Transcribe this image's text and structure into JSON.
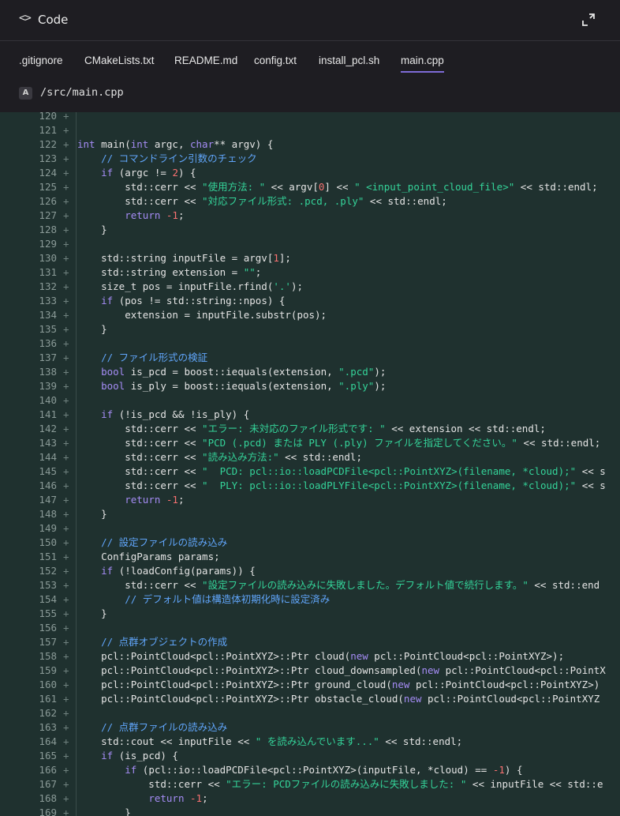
{
  "header": {
    "code_icon": "<>",
    "title": "Code",
    "expand_icon": "expand-icon"
  },
  "tabs": [
    {
      "label": ".gitignore",
      "active": false
    },
    {
      "label": "CMakeLists.txt",
      "active": false
    },
    {
      "label": "README.md",
      "active": false
    },
    {
      "label": "config.txt",
      "active": false
    },
    {
      "label": "install_pcl.sh",
      "active": false
    },
    {
      "label": "main.cpp",
      "active": true
    }
  ],
  "file": {
    "badge": "A",
    "path": "/src/main.cpp"
  },
  "colors": {
    "keyword": "#a58cf5",
    "string": "#34d399",
    "number": "#f87171",
    "comment": "#60a5fa",
    "accent": "#7e6bd6"
  },
  "lines": [
    {
      "n": "120",
      "t": [
        [
          "",
          ""
        ]
      ]
    },
    {
      "n": "121",
      "t": [
        [
          "",
          ""
        ]
      ]
    },
    {
      "n": "122",
      "t": [
        [
          "kw",
          "int"
        ],
        [
          "",
          " main("
        ],
        [
          "kw",
          "int"
        ],
        [
          "",
          " argc, "
        ],
        [
          "kw",
          "char"
        ],
        [
          "",
          "** argv) {"
        ]
      ]
    },
    {
      "n": "123",
      "t": [
        [
          "",
          "    "
        ],
        [
          "cm",
          "// コマンドライン引数のチェック"
        ]
      ]
    },
    {
      "n": "124",
      "t": [
        [
          "",
          "    "
        ],
        [
          "kw",
          "if"
        ],
        [
          "",
          " (argc != "
        ],
        [
          "num",
          "2"
        ],
        [
          "",
          ") {"
        ]
      ]
    },
    {
      "n": "125",
      "t": [
        [
          "",
          "        std::cerr << "
        ],
        [
          "str",
          "\"使用方法: \""
        ],
        [
          "",
          " << argv["
        ],
        [
          "num",
          "0"
        ],
        [
          "",
          "] << "
        ],
        [
          "str",
          "\" <input_point_cloud_file>\""
        ],
        [
          "",
          " << std::endl;"
        ]
      ]
    },
    {
      "n": "126",
      "t": [
        [
          "",
          "        std::cerr << "
        ],
        [
          "str",
          "\"対応ファイル形式: .pcd, .ply\""
        ],
        [
          "",
          " << std::endl;"
        ]
      ]
    },
    {
      "n": "127",
      "t": [
        [
          "",
          "        "
        ],
        [
          "kw",
          "return"
        ],
        [
          "",
          " "
        ],
        [
          "num",
          "-1"
        ],
        [
          "",
          ";"
        ]
      ]
    },
    {
      "n": "128",
      "t": [
        [
          "",
          "    }"
        ]
      ]
    },
    {
      "n": "129",
      "t": [
        [
          "",
          ""
        ]
      ]
    },
    {
      "n": "130",
      "t": [
        [
          "",
          "    std::string inputFile = argv["
        ],
        [
          "num",
          "1"
        ],
        [
          "",
          "];"
        ]
      ]
    },
    {
      "n": "131",
      "t": [
        [
          "",
          "    std::string extension = "
        ],
        [
          "str",
          "\"\""
        ],
        [
          "",
          ";"
        ]
      ]
    },
    {
      "n": "132",
      "t": [
        [
          "",
          "    size_t pos = inputFile.rfind("
        ],
        [
          "str",
          "'.'"
        ],
        [
          "",
          ");"
        ]
      ]
    },
    {
      "n": "133",
      "t": [
        [
          "",
          "    "
        ],
        [
          "kw",
          "if"
        ],
        [
          "",
          " (pos != std::string::npos) {"
        ]
      ]
    },
    {
      "n": "134",
      "t": [
        [
          "",
          "        extension = inputFile.substr(pos);"
        ]
      ]
    },
    {
      "n": "135",
      "t": [
        [
          "",
          "    }"
        ]
      ]
    },
    {
      "n": "136",
      "t": [
        [
          "",
          ""
        ]
      ]
    },
    {
      "n": "137",
      "t": [
        [
          "",
          "    "
        ],
        [
          "cm",
          "// ファイル形式の検証"
        ]
      ]
    },
    {
      "n": "138",
      "t": [
        [
          "",
          "    "
        ],
        [
          "kw",
          "bool"
        ],
        [
          "",
          " is_pcd = boost::iequals(extension, "
        ],
        [
          "str",
          "\".pcd\""
        ],
        [
          "",
          ");"
        ]
      ]
    },
    {
      "n": "139",
      "t": [
        [
          "",
          "    "
        ],
        [
          "kw",
          "bool"
        ],
        [
          "",
          " is_ply = boost::iequals(extension, "
        ],
        [
          "str",
          "\".ply\""
        ],
        [
          "",
          ");"
        ]
      ]
    },
    {
      "n": "140",
      "t": [
        [
          "",
          ""
        ]
      ]
    },
    {
      "n": "141",
      "t": [
        [
          "",
          "    "
        ],
        [
          "kw",
          "if"
        ],
        [
          "",
          " (!is_pcd && !is_ply) {"
        ]
      ]
    },
    {
      "n": "142",
      "t": [
        [
          "",
          "        std::cerr << "
        ],
        [
          "str",
          "\"エラー: 未対応のファイル形式です: \""
        ],
        [
          "",
          " << extension << std::endl;"
        ]
      ]
    },
    {
      "n": "143",
      "t": [
        [
          "",
          "        std::cerr << "
        ],
        [
          "str",
          "\"PCD (.pcd) または PLY (.ply) ファイルを指定してください。\""
        ],
        [
          "",
          " << std::endl;"
        ]
      ]
    },
    {
      "n": "144",
      "t": [
        [
          "",
          "        std::cerr << "
        ],
        [
          "str",
          "\"読み込み方法:\""
        ],
        [
          "",
          " << std::endl;"
        ]
      ]
    },
    {
      "n": "145",
      "t": [
        [
          "",
          "        std::cerr << "
        ],
        [
          "str",
          "\"  PCD: pcl::io::loadPCDFile<pcl::PointXYZ>(filename, *cloud);\""
        ],
        [
          "",
          " << s"
        ]
      ]
    },
    {
      "n": "146",
      "t": [
        [
          "",
          "        std::cerr << "
        ],
        [
          "str",
          "\"  PLY: pcl::io::loadPLYFile<pcl::PointXYZ>(filename, *cloud);\""
        ],
        [
          "",
          " << s"
        ]
      ]
    },
    {
      "n": "147",
      "t": [
        [
          "",
          "        "
        ],
        [
          "kw",
          "return"
        ],
        [
          "",
          " "
        ],
        [
          "num",
          "-1"
        ],
        [
          "",
          ";"
        ]
      ]
    },
    {
      "n": "148",
      "t": [
        [
          "",
          "    }"
        ]
      ]
    },
    {
      "n": "149",
      "t": [
        [
          "",
          ""
        ]
      ]
    },
    {
      "n": "150",
      "t": [
        [
          "",
          "    "
        ],
        [
          "cm",
          "// 設定ファイルの読み込み"
        ]
      ]
    },
    {
      "n": "151",
      "t": [
        [
          "",
          "    ConfigParams params;"
        ]
      ]
    },
    {
      "n": "152",
      "t": [
        [
          "",
          "    "
        ],
        [
          "kw",
          "if"
        ],
        [
          "",
          " (!loadConfig(params)) {"
        ]
      ]
    },
    {
      "n": "153",
      "t": [
        [
          "",
          "        std::cerr << "
        ],
        [
          "str",
          "\"設定ファイルの読み込みに失敗しました。デフォルト値で続行します。\""
        ],
        [
          "",
          " << std::end"
        ]
      ]
    },
    {
      "n": "154",
      "t": [
        [
          "",
          "        "
        ],
        [
          "cm",
          "// デフォルト値は構造体初期化時に設定済み"
        ]
      ]
    },
    {
      "n": "155",
      "t": [
        [
          "",
          "    }"
        ]
      ]
    },
    {
      "n": "156",
      "t": [
        [
          "",
          ""
        ]
      ]
    },
    {
      "n": "157",
      "t": [
        [
          "",
          "    "
        ],
        [
          "cm",
          "// 点群オブジェクトの作成"
        ]
      ]
    },
    {
      "n": "158",
      "t": [
        [
          "",
          "    pcl::PointCloud<pcl::PointXYZ>::Ptr cloud("
        ],
        [
          "kw",
          "new"
        ],
        [
          "",
          " pcl::PointCloud<pcl::PointXYZ>);"
        ]
      ]
    },
    {
      "n": "159",
      "t": [
        [
          "",
          "    pcl::PointCloud<pcl::PointXYZ>::Ptr cloud_downsampled("
        ],
        [
          "kw",
          "new"
        ],
        [
          "",
          " pcl::PointCloud<pcl::PointX"
        ]
      ]
    },
    {
      "n": "160",
      "t": [
        [
          "",
          "    pcl::PointCloud<pcl::PointXYZ>::Ptr ground_cloud("
        ],
        [
          "kw",
          "new"
        ],
        [
          "",
          " pcl::PointCloud<pcl::PointXYZ>)"
        ]
      ]
    },
    {
      "n": "161",
      "t": [
        [
          "",
          "    pcl::PointCloud<pcl::PointXYZ>::Ptr obstacle_cloud("
        ],
        [
          "kw",
          "new"
        ],
        [
          "",
          " pcl::PointCloud<pcl::PointXYZ"
        ]
      ]
    },
    {
      "n": "162",
      "t": [
        [
          "",
          ""
        ]
      ]
    },
    {
      "n": "163",
      "t": [
        [
          "",
          "    "
        ],
        [
          "cm",
          "// 点群ファイルの読み込み"
        ]
      ]
    },
    {
      "n": "164",
      "t": [
        [
          "",
          "    std::cout << inputFile << "
        ],
        [
          "str",
          "\" を読み込んでいます...\""
        ],
        [
          "",
          " << std::endl;"
        ]
      ]
    },
    {
      "n": "165",
      "t": [
        [
          "",
          "    "
        ],
        [
          "kw",
          "if"
        ],
        [
          "",
          " (is_pcd) {"
        ]
      ]
    },
    {
      "n": "166",
      "t": [
        [
          "",
          "        "
        ],
        [
          "kw",
          "if"
        ],
        [
          "",
          " (pcl::io::loadPCDFile<pcl::PointXYZ>(inputFile, *cloud) == "
        ],
        [
          "num",
          "-1"
        ],
        [
          "",
          ") {"
        ]
      ]
    },
    {
      "n": "167",
      "t": [
        [
          "",
          "            std::cerr << "
        ],
        [
          "str",
          "\"エラー: PCDファイルの読み込みに失敗しました: \""
        ],
        [
          "",
          " << inputFile << std::e"
        ]
      ]
    },
    {
      "n": "168",
      "t": [
        [
          "",
          "            "
        ],
        [
          "kw",
          "return"
        ],
        [
          "",
          " "
        ],
        [
          "num",
          "-1"
        ],
        [
          "",
          ";"
        ]
      ]
    },
    {
      "n": "169",
      "t": [
        [
          "",
          "        }"
        ]
      ]
    }
  ]
}
